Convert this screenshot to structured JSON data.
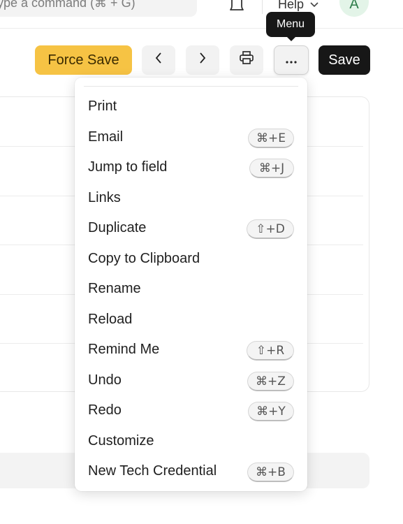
{
  "navbar": {
    "search_placeholder": "ype a command (⌘ + G)",
    "help_label": "Help",
    "avatar_initial": "A"
  },
  "toolbar": {
    "force_save_label": "Force Save",
    "save_label": "Save",
    "tooltip": "Menu"
  },
  "menu": {
    "items": [
      {
        "label": "Print",
        "shortcut": ""
      },
      {
        "label": "Email",
        "shortcut": "⌘+E"
      },
      {
        "label": "Jump to field",
        "shortcut": "⌘+J"
      },
      {
        "label": "Links",
        "shortcut": ""
      },
      {
        "label": "Duplicate",
        "shortcut": "⇧+D"
      },
      {
        "label": "Copy to Clipboard",
        "shortcut": ""
      },
      {
        "label": "Rename",
        "shortcut": ""
      },
      {
        "label": "Reload",
        "shortcut": ""
      },
      {
        "label": "Remind Me",
        "shortcut": "⇧+R"
      },
      {
        "label": "Undo",
        "shortcut": "⌘+Z"
      },
      {
        "label": "Redo",
        "shortcut": "⌘+Y"
      },
      {
        "label": "Customize",
        "shortcut": ""
      },
      {
        "label": "New Tech Credential",
        "shortcut": "⌘+B"
      }
    ]
  },
  "colors": {
    "force_save_bg": "#f6c344",
    "save_bg": "#171717",
    "avatar_bg": "#e3f4e8",
    "avatar_text": "#2f7d4b"
  },
  "icons": [
    "bell-icon",
    "chevron-down-icon",
    "chevron-left-icon",
    "chevron-right-icon",
    "printer-icon",
    "more-horizontal-icon"
  ]
}
